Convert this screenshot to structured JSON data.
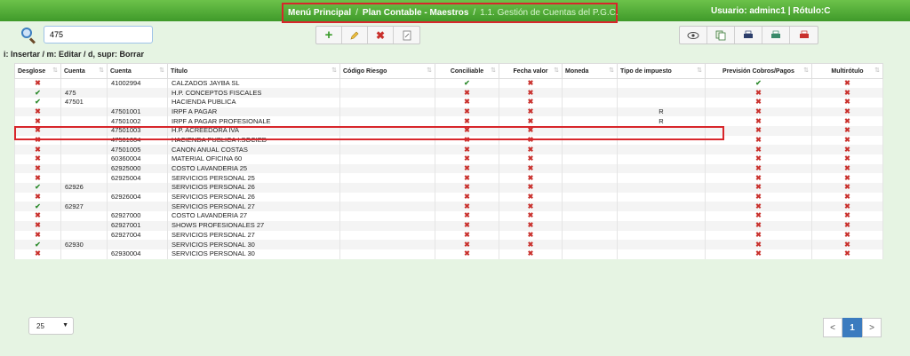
{
  "header": {
    "breadcrumb": [
      "Menú Principal",
      "Plan Contable - Maestros",
      "1.1. Gestión de Cuentas del P.G.C."
    ],
    "separator": "/",
    "user_info": "Usuario: adminc1 | Rótulo:C"
  },
  "search": {
    "value": "475"
  },
  "toolbar_left": [
    "add-icon",
    "edit-icon",
    "delete-icon",
    "export-icon"
  ],
  "toolbar_right": [
    "view-icon",
    "copy-icon",
    "print-icon",
    "printer-icon",
    "pdf-icon"
  ],
  "hint": "i: Insertar / m: Editar / d, supr: Borrar",
  "table": {
    "columns": [
      "Desglose",
      "Cuenta",
      "Cuenta",
      "Título",
      "Código Riesgo",
      "Conciliable",
      "Fecha valor",
      "Moneda",
      "Tipo de impuesto",
      "Previsión Cobros/Pagos",
      "Multirótulo"
    ],
    "rows": [
      {
        "desglose": "x",
        "cuenta1": "",
        "cuenta2": "41002994",
        "titulo": "CALZADOS JAYBA SL",
        "riesgo": "",
        "conciliable": "v",
        "fecha": "x",
        "moneda": "",
        "tipo": "",
        "prevision": "v",
        "multi": "x"
      },
      {
        "desglose": "v",
        "cuenta1": "475",
        "cuenta2": "",
        "titulo": "H.P. CONCEPTOS FISCALES",
        "riesgo": "",
        "conciliable": "x",
        "fecha": "x",
        "moneda": "",
        "tipo": "",
        "prevision": "x",
        "multi": "x"
      },
      {
        "desglose": "v",
        "cuenta1": "47501",
        "cuenta2": "",
        "titulo": "HACIENDA PUBLICA",
        "riesgo": "",
        "conciliable": "x",
        "fecha": "x",
        "moneda": "",
        "tipo": "",
        "prevision": "x",
        "multi": "x"
      },
      {
        "desglose": "x",
        "cuenta1": "",
        "cuenta2": "47501001",
        "titulo": "IRPF A PAGAR",
        "riesgo": "",
        "conciliable": "x",
        "fecha": "x",
        "moneda": "",
        "tipo": "R",
        "prevision": "x",
        "multi": "x"
      },
      {
        "desglose": "x",
        "cuenta1": "",
        "cuenta2": "47501002",
        "titulo": "IRPF A PAGAR PROFESIONALE",
        "riesgo": "",
        "conciliable": "x",
        "fecha": "x",
        "moneda": "",
        "tipo": "R",
        "prevision": "x",
        "multi": "x"
      },
      {
        "desglose": "x",
        "cuenta1": "",
        "cuenta2": "47501003",
        "titulo": "H.P. ACREEDORA IVA",
        "riesgo": "",
        "conciliable": "x",
        "fecha": "x",
        "moneda": "",
        "tipo": "",
        "prevision": "x",
        "multi": "x"
      },
      {
        "desglose": "x",
        "cuenta1": "",
        "cuenta2": "47501004",
        "titulo": "HACIENDA PUBLICA I.SOCIED",
        "riesgo": "",
        "conciliable": "x",
        "fecha": "x",
        "moneda": "",
        "tipo": "",
        "prevision": "x",
        "multi": "x"
      },
      {
        "desglose": "x",
        "cuenta1": "",
        "cuenta2": "47501005",
        "titulo": "CANON ANUAL COSTAS",
        "riesgo": "",
        "conciliable": "x",
        "fecha": "x",
        "moneda": "",
        "tipo": "",
        "prevision": "x",
        "multi": "x"
      },
      {
        "desglose": "x",
        "cuenta1": "",
        "cuenta2": "60360004",
        "titulo": "MATERIAL OFICINA 60",
        "riesgo": "",
        "conciliable": "x",
        "fecha": "x",
        "moneda": "",
        "tipo": "",
        "prevision": "x",
        "multi": "x"
      },
      {
        "desglose": "x",
        "cuenta1": "",
        "cuenta2": "62925000",
        "titulo": "COSTO LAVANDERIA 25",
        "riesgo": "",
        "conciliable": "x",
        "fecha": "x",
        "moneda": "",
        "tipo": "",
        "prevision": "x",
        "multi": "x"
      },
      {
        "desglose": "x",
        "cuenta1": "",
        "cuenta2": "62925004",
        "titulo": "SERVICIOS PERSONAL 25",
        "riesgo": "",
        "conciliable": "x",
        "fecha": "x",
        "moneda": "",
        "tipo": "",
        "prevision": "x",
        "multi": "x"
      },
      {
        "desglose": "v",
        "cuenta1": "62926",
        "cuenta2": "",
        "titulo": "SERVICIOS PERSONAL 26",
        "riesgo": "",
        "conciliable": "x",
        "fecha": "x",
        "moneda": "",
        "tipo": "",
        "prevision": "x",
        "multi": "x"
      },
      {
        "desglose": "x",
        "cuenta1": "",
        "cuenta2": "62926004",
        "titulo": "SERVICIOS PERSONAL 26",
        "riesgo": "",
        "conciliable": "x",
        "fecha": "x",
        "moneda": "",
        "tipo": "",
        "prevision": "x",
        "multi": "x"
      },
      {
        "desglose": "v",
        "cuenta1": "62927",
        "cuenta2": "",
        "titulo": "SERVICIOS PERSONAL 27",
        "riesgo": "",
        "conciliable": "x",
        "fecha": "x",
        "moneda": "",
        "tipo": "",
        "prevision": "x",
        "multi": "x"
      },
      {
        "desglose": "x",
        "cuenta1": "",
        "cuenta2": "62927000",
        "titulo": "COSTO LAVANDERIA 27",
        "riesgo": "",
        "conciliable": "x",
        "fecha": "x",
        "moneda": "",
        "tipo": "",
        "prevision": "x",
        "multi": "x"
      },
      {
        "desglose": "x",
        "cuenta1": "",
        "cuenta2": "62927001",
        "titulo": "SHOWS PROFESIONALES 27",
        "riesgo": "",
        "conciliable": "x",
        "fecha": "x",
        "moneda": "",
        "tipo": "",
        "prevision": "x",
        "multi": "x"
      },
      {
        "desglose": "x",
        "cuenta1": "",
        "cuenta2": "62927004",
        "titulo": "SERVICIOS PERSONAL 27",
        "riesgo": "",
        "conciliable": "x",
        "fecha": "x",
        "moneda": "",
        "tipo": "",
        "prevision": "x",
        "multi": "x"
      },
      {
        "desglose": "v",
        "cuenta1": "62930",
        "cuenta2": "",
        "titulo": "SERVICIOS PERSONAL 30",
        "riesgo": "",
        "conciliable": "x",
        "fecha": "x",
        "moneda": "",
        "tipo": "",
        "prevision": "x",
        "multi": "x"
      },
      {
        "desglose": "x",
        "cuenta1": "",
        "cuenta2": "62930004",
        "titulo": "SERVICIOS PERSONAL 30",
        "riesgo": "",
        "conciliable": "x",
        "fecha": "x",
        "moneda": "",
        "tipo": "",
        "prevision": "x",
        "multi": "x"
      }
    ]
  },
  "pagination": {
    "page_size": "25",
    "prev": "<",
    "current": "1",
    "next": ">"
  }
}
